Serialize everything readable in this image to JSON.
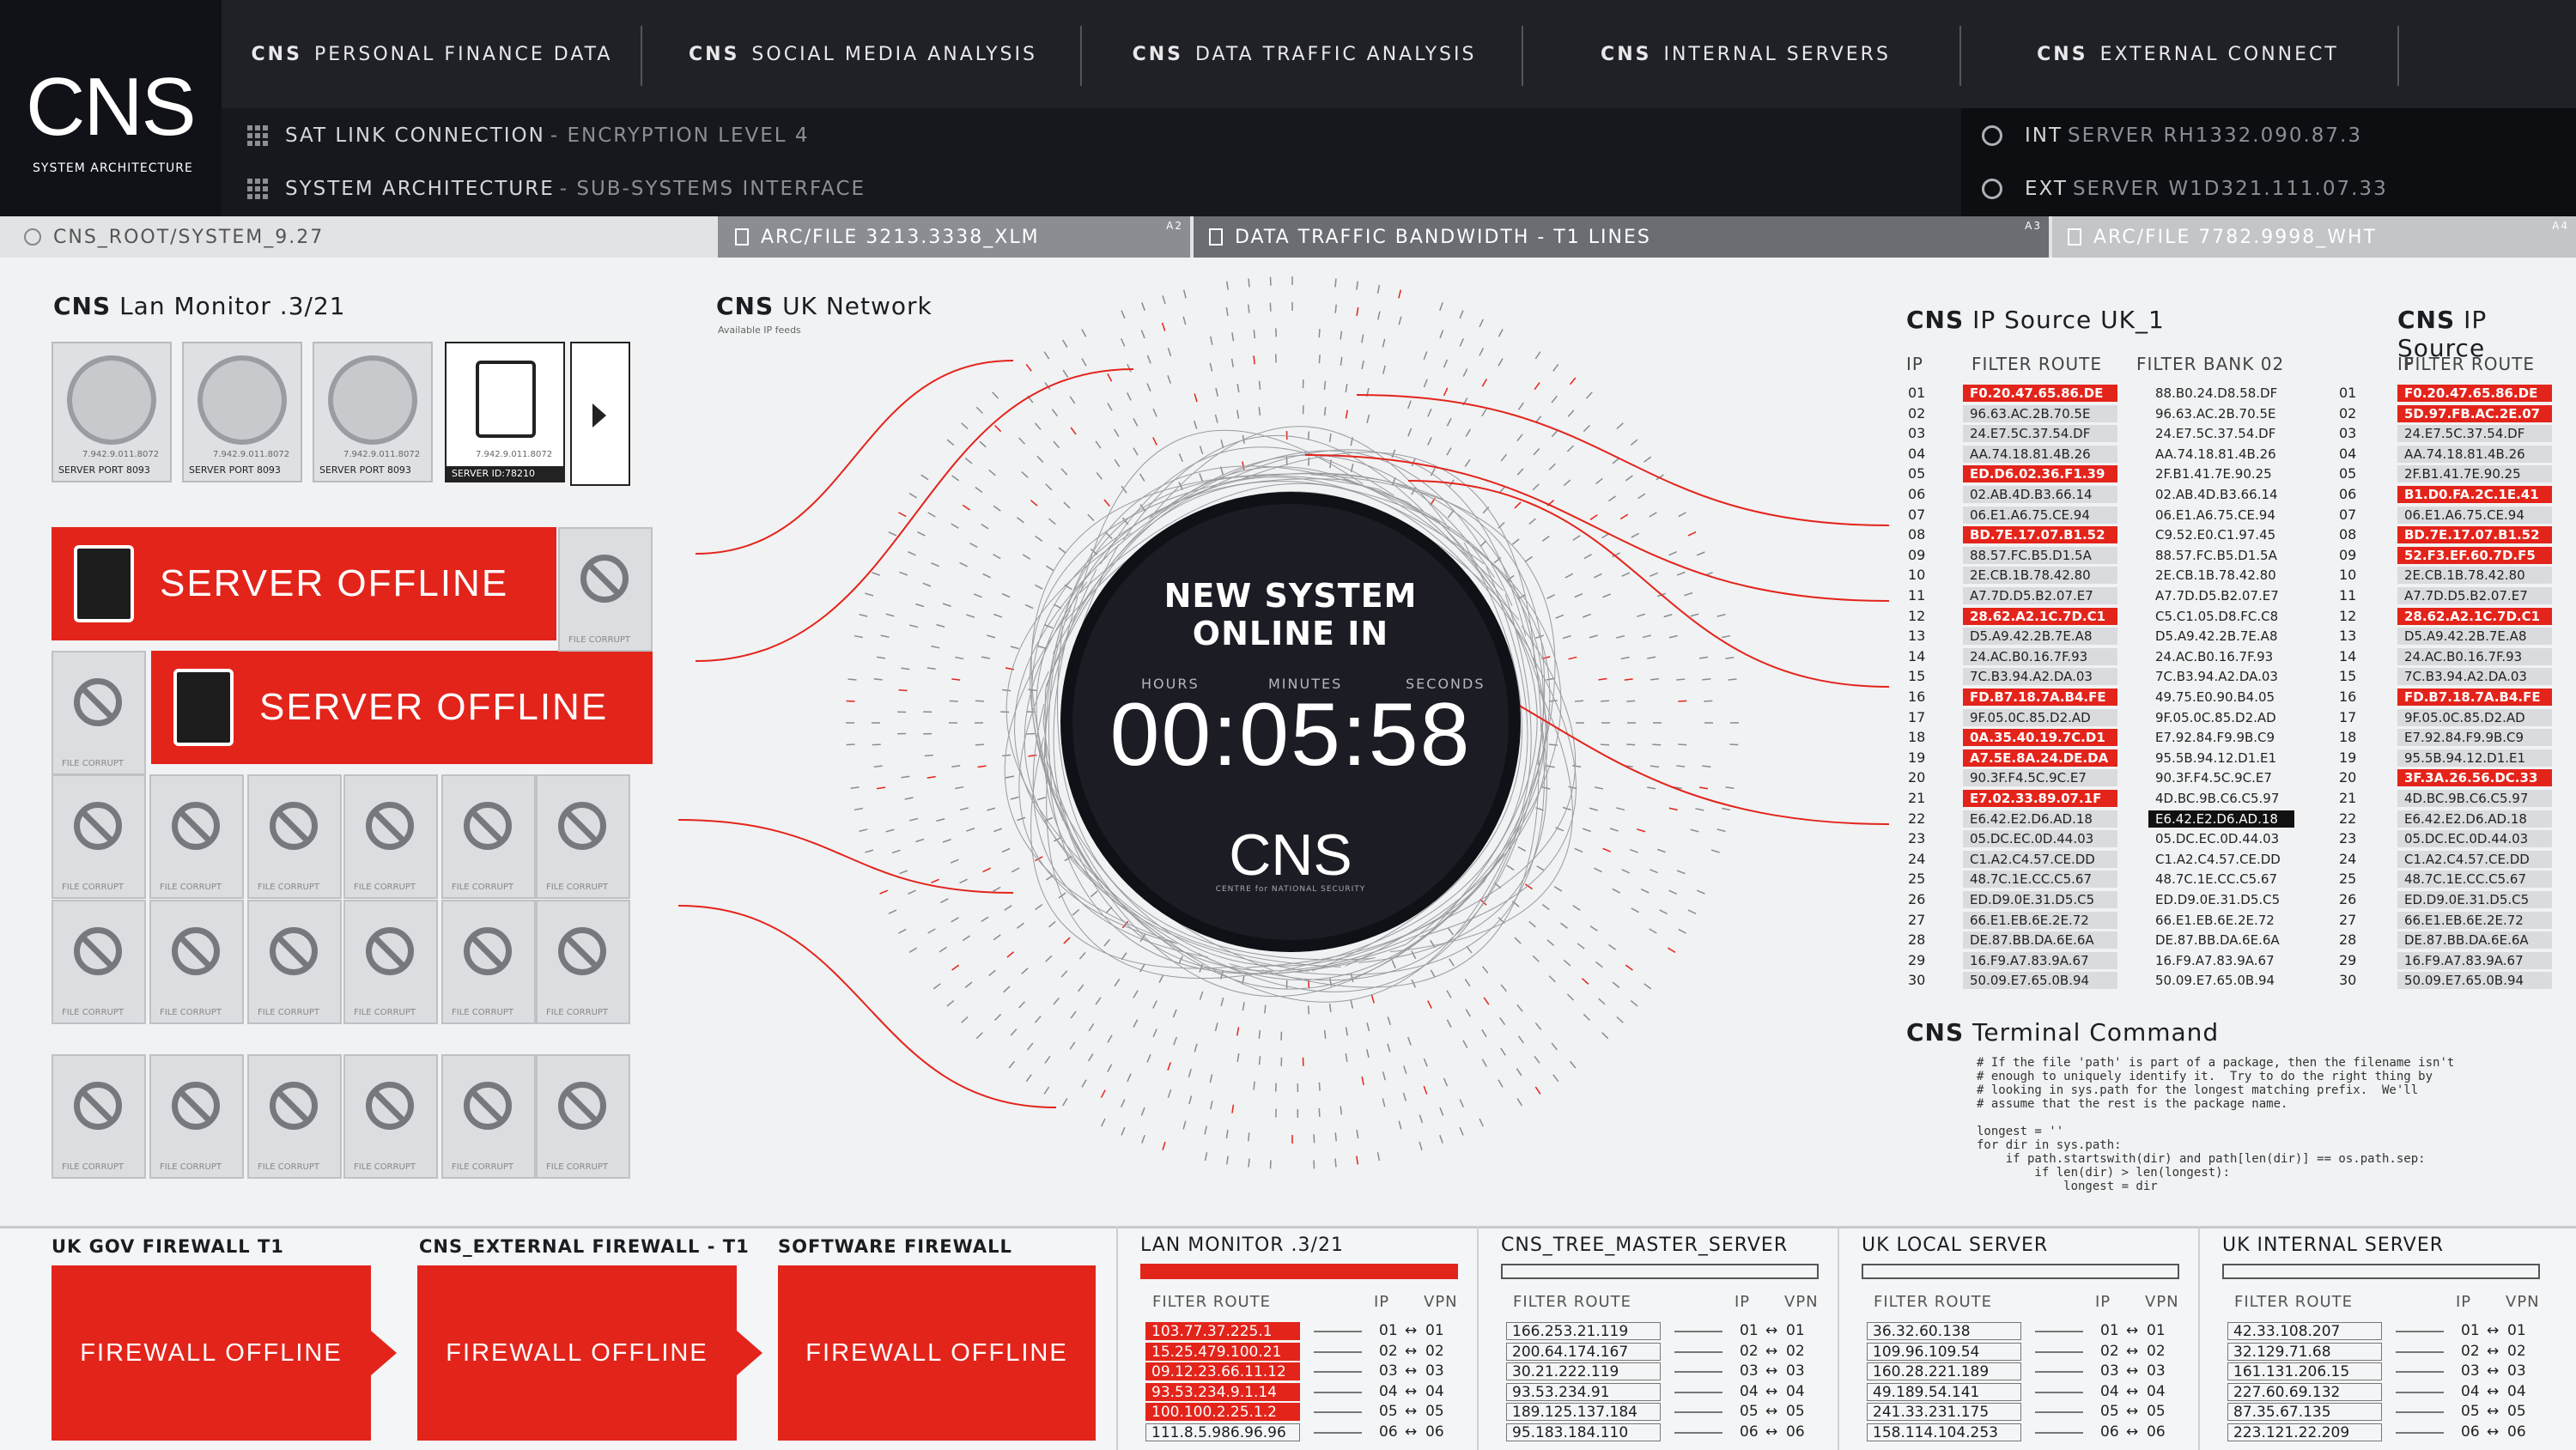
{
  "logo": {
    "text": "CNS",
    "subtitle": "SYSTEM ARCHITECTURE"
  },
  "nav": [
    {
      "cns": "CNS",
      "label": "PERSONAL FINANCE DATA"
    },
    {
      "cns": "CNS",
      "label": "SOCIAL MEDIA ANALYSIS"
    },
    {
      "cns": "CNS",
      "label": "DATA TRAFFIC ANALYSIS"
    },
    {
      "cns": "CNS",
      "label": "INTERNAL SERVERS"
    },
    {
      "cns": "CNS",
      "label": "EXTERNAL CONNECT"
    }
  ],
  "bar2": {
    "row1": {
      "label": "SAT LINK CONNECTION",
      "dim": "- ENCRYPTION LEVEL 4"
    },
    "row2": {
      "label": "SYSTEM ARCHITECTURE",
      "dim": "- SUB-SYSTEMS INTERFACE"
    },
    "int_server": {
      "label": "INT",
      "dim": "SERVER RH1332.090.87.3"
    },
    "ext_server": {
      "label": "EXT",
      "dim": "SERVER W1D321.111.07.33"
    }
  },
  "tabs": {
    "root": "CNS_ROOT/SYSTEM_9.27",
    "arc1": "ARC/FILE 3213.3338_XLM",
    "arc1_tag": "A2",
    "traffic": "DATA TRAFFIC BANDWIDTH - T1 LINES",
    "traffic_tag": "A3",
    "arc2": "ARC/FILE 7782.9998_WHT",
    "arc2_tag": "A4"
  },
  "lan": {
    "cns": "CNS",
    "title": "Lan Monitor .3/21",
    "servers": [
      {
        "label": "SERVER PORT 8093",
        "id": "7.942.9.011.8072"
      },
      {
        "label": "SERVER PORT 8093",
        "id": "7.942.9.011.8072"
      },
      {
        "label": "SERVER PORT 8093",
        "id": "7.942.9.011.8072"
      },
      {
        "label": "SERVER ID:78210",
        "id": "7.942.9.011.8072"
      }
    ],
    "offline1": "SERVER OFFLINE",
    "offline2": "SERVER OFFLINE",
    "tile_label": "FILE CORRUPT"
  },
  "uk_network": {
    "cns": "CNS",
    "title": "UK Network",
    "sub": "Available IP feeds"
  },
  "clock": {
    "title1": "NEW SYSTEM",
    "title2": "ONLINE IN",
    "hours": "HOURS",
    "minutes": "MINUTES",
    "seconds": "SECONDS",
    "time": "00:05:58",
    "logo": "CNS",
    "logo_sub": "CENTRE for NATIONAL SECURITY"
  },
  "ip_uk": {
    "cns": "CNS",
    "title": "IP Source UK_1",
    "col_ip": "IP",
    "col_route": "FILTER ROUTE",
    "col_bank": "FILTER BANK 02",
    "routes": [
      "F0.20.47.65.86.DE",
      "96.63.AC.2B.70.5E",
      "24.E7.5C.37.54.DF",
      "AA.74.18.81.4B.26",
      "ED.D6.02.36.F1.39",
      "02.AB.4D.B3.66.14",
      "06.E1.A6.75.CE.94",
      "BD.7E.17.07.B1.52",
      "88.57.FC.B5.D1.5A",
      "2E.CB.1B.78.42.80",
      "A7.7D.D5.B2.07.E7",
      "28.62.A2.1C.7D.C1",
      "D5.A9.42.2B.7E.A8",
      "24.AC.B0.16.7F.93",
      "7C.B3.94.A2.DA.03",
      "FD.B7.18.7A.B4.FE",
      "9F.05.0C.85.D2.AD",
      "0A.35.40.19.7C.D1",
      "A7.5E.8A.24.DE.DA",
      "90.3F.F4.5C.9C.E7",
      "E7.02.33.89.07.1F",
      "E6.42.E2.D6.AD.18",
      "05.DC.EC.0D.44.03",
      "C1.A2.C4.57.CE.DD",
      "48.7C.1E.CC.C5.67",
      "ED.D9.0E.31.D5.C5",
      "66.E1.EB.6E.2E.72",
      "DE.87.BB.DA.6E.6A",
      "16.F9.A7.83.9A.67",
      "50.09.E7.65.0B.94"
    ],
    "banks": [
      "88.B0.24.D8.58.DF",
      "96.63.AC.2B.70.5E",
      "24.E7.5C.37.54.DF",
      "AA.74.18.81.4B.26",
      "2F.B1.41.7E.90.25",
      "02.AB.4D.B3.66.14",
      "06.E1.A6.75.CE.94",
      "C9.52.E0.C1.97.45",
      "88.57.FC.B5.D1.5A",
      "2E.CB.1B.78.42.80",
      "A7.7D.D5.B2.07.E7",
      "C5.C1.05.D8.FC.C8",
      "D5.A9.42.2B.7E.A8",
      "24.AC.B0.16.7F.93",
      "7C.B3.94.A2.DA.03",
      "49.75.E0.90.B4.05",
      "9F.05.0C.85.D2.AD",
      "E7.92.84.F9.9B.C9",
      "95.5B.94.12.D1.E1",
      "90.3F.F4.5C.9C.E7",
      "4D.BC.9B.C6.C5.97",
      "E6.42.E2.D6.AD.18",
      "05.DC.EC.0D.44.03",
      "C1.A2.C4.57.CE.DD",
      "48.7C.1E.CC.C5.67",
      "ED.D9.0E.31.D5.C5",
      "66.E1.EB.6E.2E.72",
      "DE.87.BB.DA.6E.6A",
      "16.F9.A7.83.9A.67",
      "50.09.E7.65.0B.94"
    ],
    "red": [
      0,
      4,
      7,
      11,
      15,
      17,
      18,
      20
    ]
  },
  "ip_uk2": {
    "cns": "CNS",
    "title": "IP Source",
    "col_ip": "IP",
    "col_route": "FILTER ROUTE",
    "routes": [
      "F0.20.47.65.86.DE",
      "5D.97.FB.AC.2E.07",
      "24.E7.5C.37.54.DF",
      "AA.74.18.81.4B.26",
      "2F.B1.41.7E.90.25",
      "B1.D0.FA.2C.1E.41",
      "06.E1.A6.75.CE.94",
      "BD.7E.17.07.B1.52",
      "52.F3.EF.60.7D.F5",
      "2E.CB.1B.78.42.80",
      "A7.7D.D5.B2.07.E7",
      "28.62.A2.1C.7D.C1",
      "D5.A9.42.2B.7E.A8",
      "24.AC.B0.16.7F.93",
      "7C.B3.94.A2.DA.03",
      "FD.B7.18.7A.B4.FE",
      "9F.05.0C.85.D2.AD",
      "E7.92.84.F9.9B.C9",
      "95.5B.94.12.D1.E1",
      "3F.3A.26.56.DC.33",
      "4D.BC.9B.C6.C5.97",
      "E6.42.E2.D6.AD.18",
      "05.DC.EC.0D.44.03",
      "C1.A2.C4.57.CE.DD",
      "48.7C.1E.CC.C5.67",
      "ED.D9.0E.31.D5.C5",
      "66.E1.EB.6E.2E.72",
      "DE.87.BB.DA.6E.6A",
      "16.F9.A7.83.9A.67",
      "50.09.E7.65.0B.94"
    ],
    "red": [
      0,
      1,
      5,
      7,
      8,
      11,
      15,
      19
    ]
  },
  "terminal": {
    "cns": "CNS",
    "title": "Terminal Command",
    "code": "# If the file 'path' is part of a package, then the filename isn't\n# enough to uniquely identify it.  Try to do the right thing by\n# looking in sys.path for the longest matching prefix.  We'll\n# assume that the rest is the package name.\n\nlongest = ''\nfor dir in sys.path:\n    if path.startswith(dir) and path[len(dir)] == os.path.sep:\n        if len(dir) > len(longest):\n            longest = dir"
  },
  "firewalls": [
    {
      "title": "UK GOV FIREWALL T1",
      "status": "FIREWALL OFFLINE"
    },
    {
      "title": "CNS_EXTERNAL FIREWALL - T1",
      "status": "FIREWALL OFFLINE"
    },
    {
      "title": "SOFTWARE FIREWALL",
      "status": "FIREWALL OFFLINE"
    }
  ],
  "panels": [
    {
      "title": "LAN MONITOR .3/21",
      "route": "FILTER ROUTE",
      "ip": "IP",
      "vpn": "VPN",
      "rows": [
        "103.77.37.225.1",
        "15.25.479.100.21",
        "09.12.23.66.11.12",
        "93.53.234.9.1.14",
        "100.100.2.25.1.2",
        "111.8.5.986.96.96"
      ],
      "red": true
    },
    {
      "title": "CNS_TREE_MASTER_SERVER",
      "route": "FILTER ROUTE",
      "ip": "IP",
      "vpn": "VPN",
      "rows": [
        "166.253.21.119",
        "200.64.174.167",
        "30.21.222.119",
        "93.53.234.91",
        "189.125.137.184",
        "95.183.184.110"
      ],
      "red": false
    },
    {
      "title": "UK LOCAL SERVER",
      "route": "FILTER ROUTE",
      "ip": "IP",
      "vpn": "VPN",
      "rows": [
        "36.32.60.138",
        "109.96.109.54",
        "160.28.221.189",
        "49.189.54.141",
        "241.33.231.175",
        "158.114.104.253"
      ],
      "red": false
    },
    {
      "title": "UK INTERNAL SERVER",
      "route": "FILTER ROUTE",
      "ip": "IP",
      "vpn": "VPN",
      "rows": [
        "42.33.108.207",
        "32.129.71.68",
        "161.131.206.15",
        "227.60.69.132",
        "87.35.67.135",
        "223.121.22.209"
      ],
      "red": false
    }
  ],
  "row_numbers": [
    "01",
    "02",
    "03",
    "04",
    "05",
    "06",
    "07",
    "08",
    "09",
    "10",
    "11",
    "12",
    "13",
    "14",
    "15",
    "16",
    "17",
    "18",
    "19",
    "20",
    "21",
    "22",
    "23",
    "24",
    "25",
    "26",
    "27",
    "28",
    "29",
    "30"
  ],
  "colors": {
    "accent": "#e3241b",
    "dark": "#1b1c24",
    "bg": "#f1f2f3"
  }
}
